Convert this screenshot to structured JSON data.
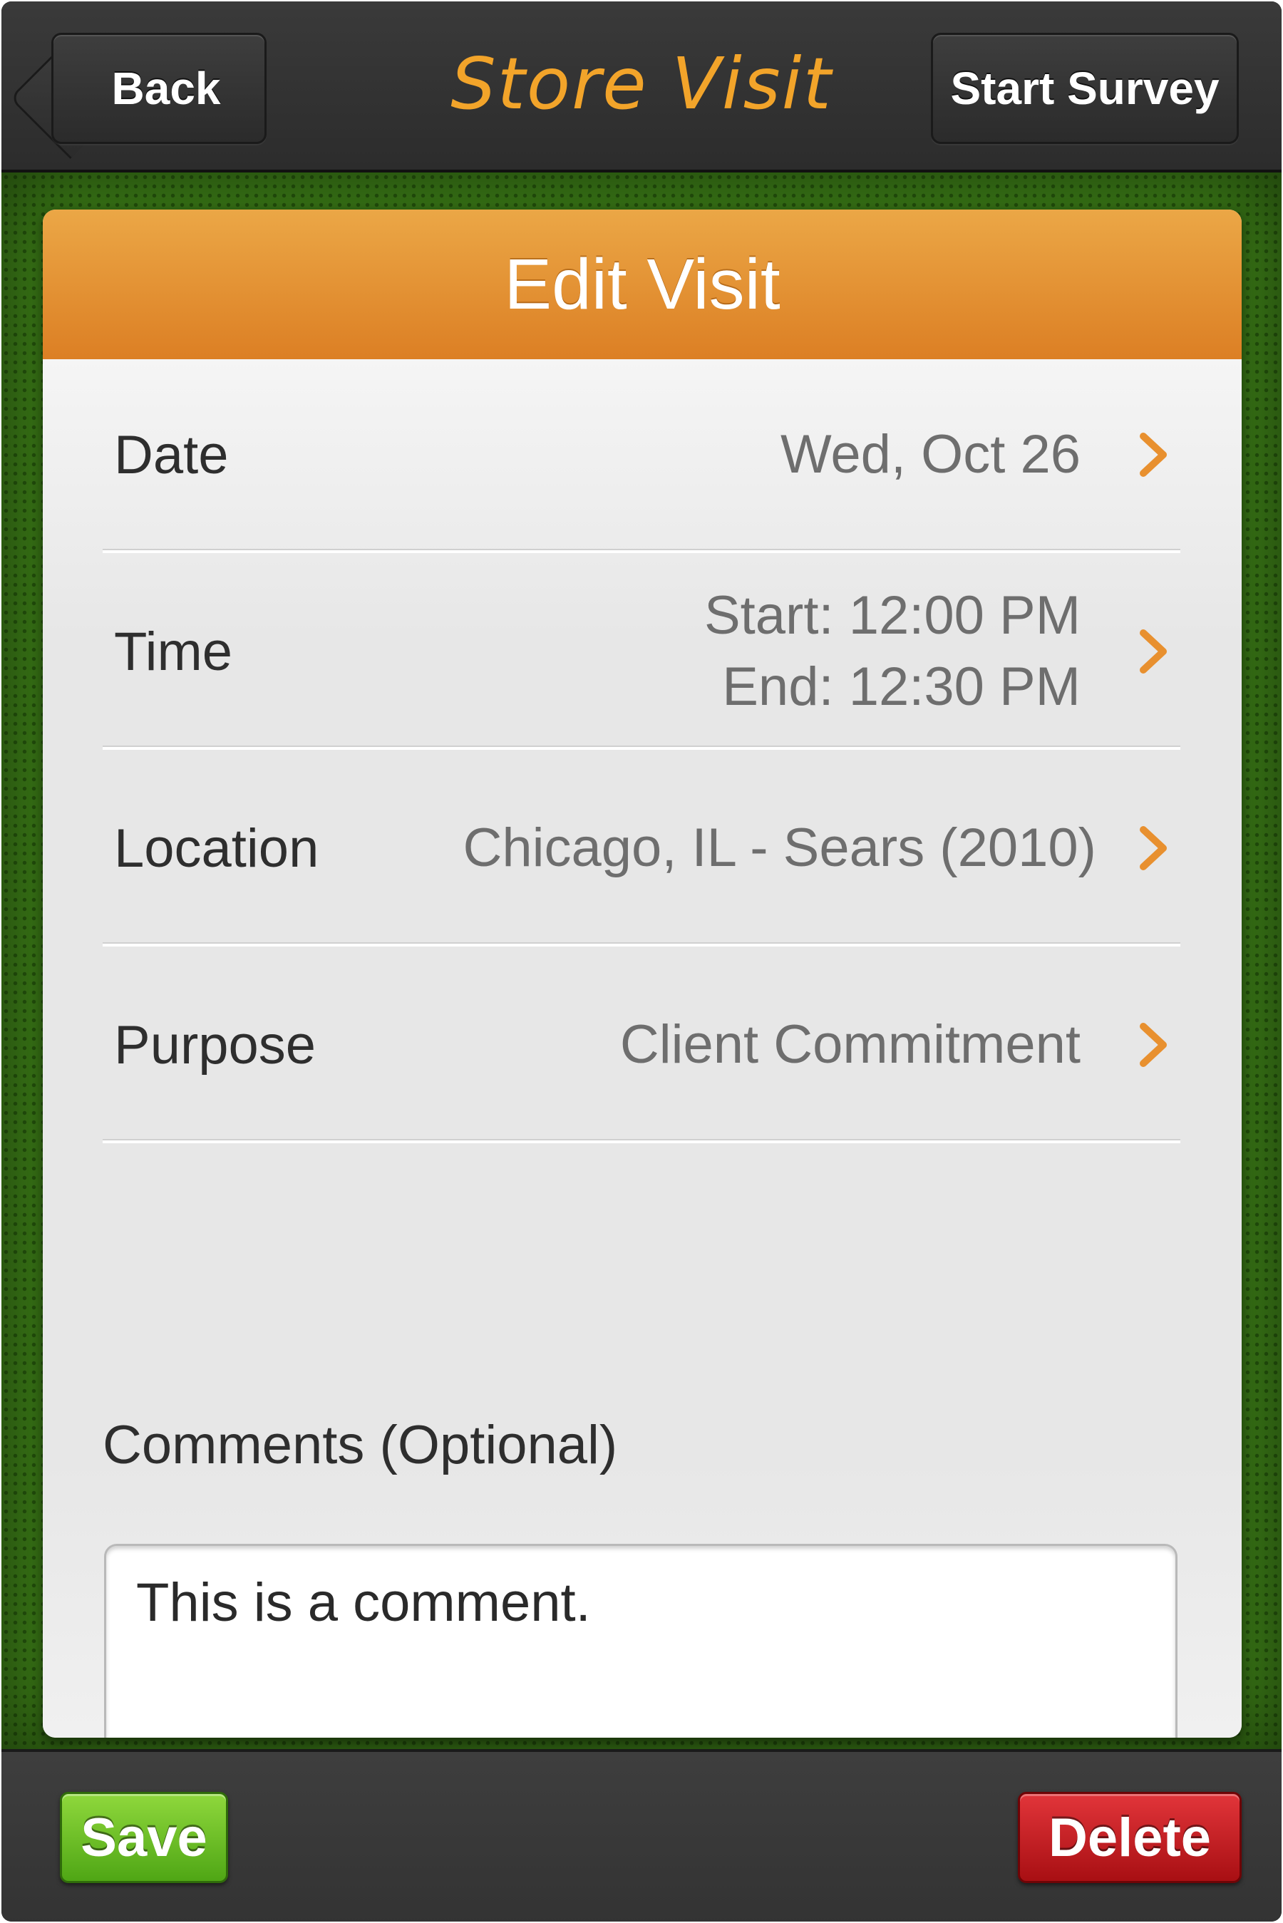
{
  "navbar": {
    "back_label": "Back",
    "title": "Store Visit",
    "start_survey_label": "Start Survey"
  },
  "card": {
    "title": "Edit Visit"
  },
  "rows": [
    {
      "label": "Date",
      "value": "Wed, Oct 26"
    },
    {
      "label": "Time",
      "value_start": "Start: 12:00 PM",
      "value_end": "End: 12:30 PM"
    },
    {
      "label": "Location",
      "value": "Chicago, IL - Sears (2010)"
    },
    {
      "label": "Purpose",
      "value": "Client Commitment"
    }
  ],
  "comments": {
    "label": "Comments (Optional)",
    "value": "This is a comment."
  },
  "toolbar": {
    "save_label": "Save",
    "delete_label": "Delete"
  },
  "colors": {
    "accent_orange": "#e8902f",
    "title_gold": "#f2a42a",
    "background_green": "#3b7a17",
    "save_green": "#5db31b",
    "delete_red": "#c8181d"
  },
  "icons": {
    "back": "back-arrow-icon",
    "disclosure": "chevron-right-icon"
  }
}
